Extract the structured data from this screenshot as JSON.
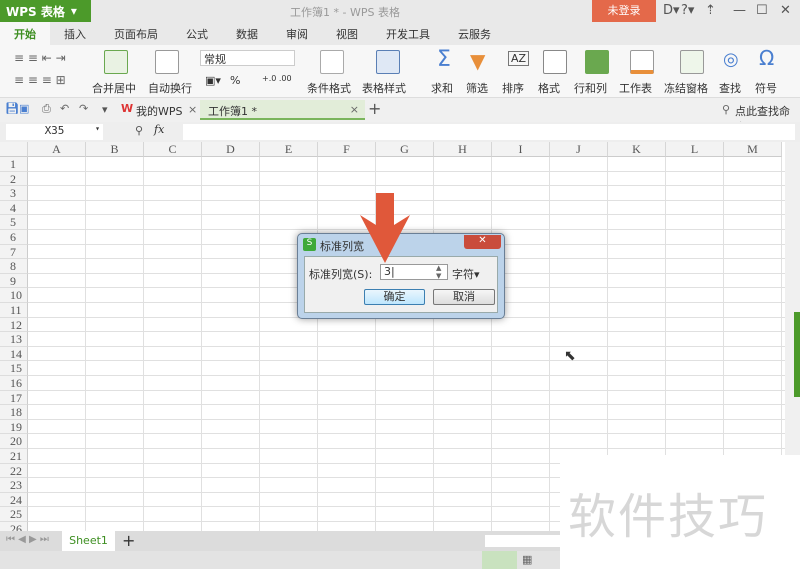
{
  "app": {
    "logo": "WPS 表格",
    "title": "工作簿1 * - WPS 表格",
    "login": "未登录"
  },
  "tabs": [
    "开始",
    "插入",
    "页面布局",
    "公式",
    "数据",
    "审阅",
    "视图",
    "开发工具",
    "云服务"
  ],
  "ribbon": {
    "merge": "合并居中",
    "wrap": "自动换行",
    "format_select": "常规",
    "percent": "%",
    "cond_format": "条件格式",
    "table_style": "表格样式",
    "sum": "求和",
    "filter": "筛选",
    "sort": "排序",
    "format": "格式",
    "rowcol": "行和列",
    "sheet": "工作表",
    "freeze": "冻结窗格",
    "find": "查找",
    "symbol": "符号"
  },
  "quickbar": {
    "mywps": "我的WPS",
    "doc": "工作簿1 *",
    "search": "点此查找命令"
  },
  "formula": {
    "namebox": "X35",
    "fx": "fx",
    "value": ""
  },
  "columns": [
    "A",
    "B",
    "C",
    "D",
    "E",
    "F",
    "G",
    "H",
    "I",
    "J",
    "K",
    "L",
    "M"
  ],
  "rows": [
    "1",
    "2",
    "3",
    "4",
    "5",
    "6",
    "7",
    "8",
    "9",
    "10",
    "11",
    "12",
    "13",
    "14",
    "15",
    "16",
    "17",
    "18",
    "19",
    "20",
    "21",
    "22",
    "23",
    "24",
    "25",
    "26"
  ],
  "sheets": [
    "Sheet1"
  ],
  "dialog": {
    "title": "标准列宽",
    "label": "标准列宽(S):",
    "value": "3",
    "unit": "字符",
    "ok": "确定",
    "cancel": "取消"
  },
  "watermark": "软件技巧",
  "colors": {
    "brand": "#4c9a2a",
    "login": "#e4694a",
    "arrow": "#e0583a"
  }
}
